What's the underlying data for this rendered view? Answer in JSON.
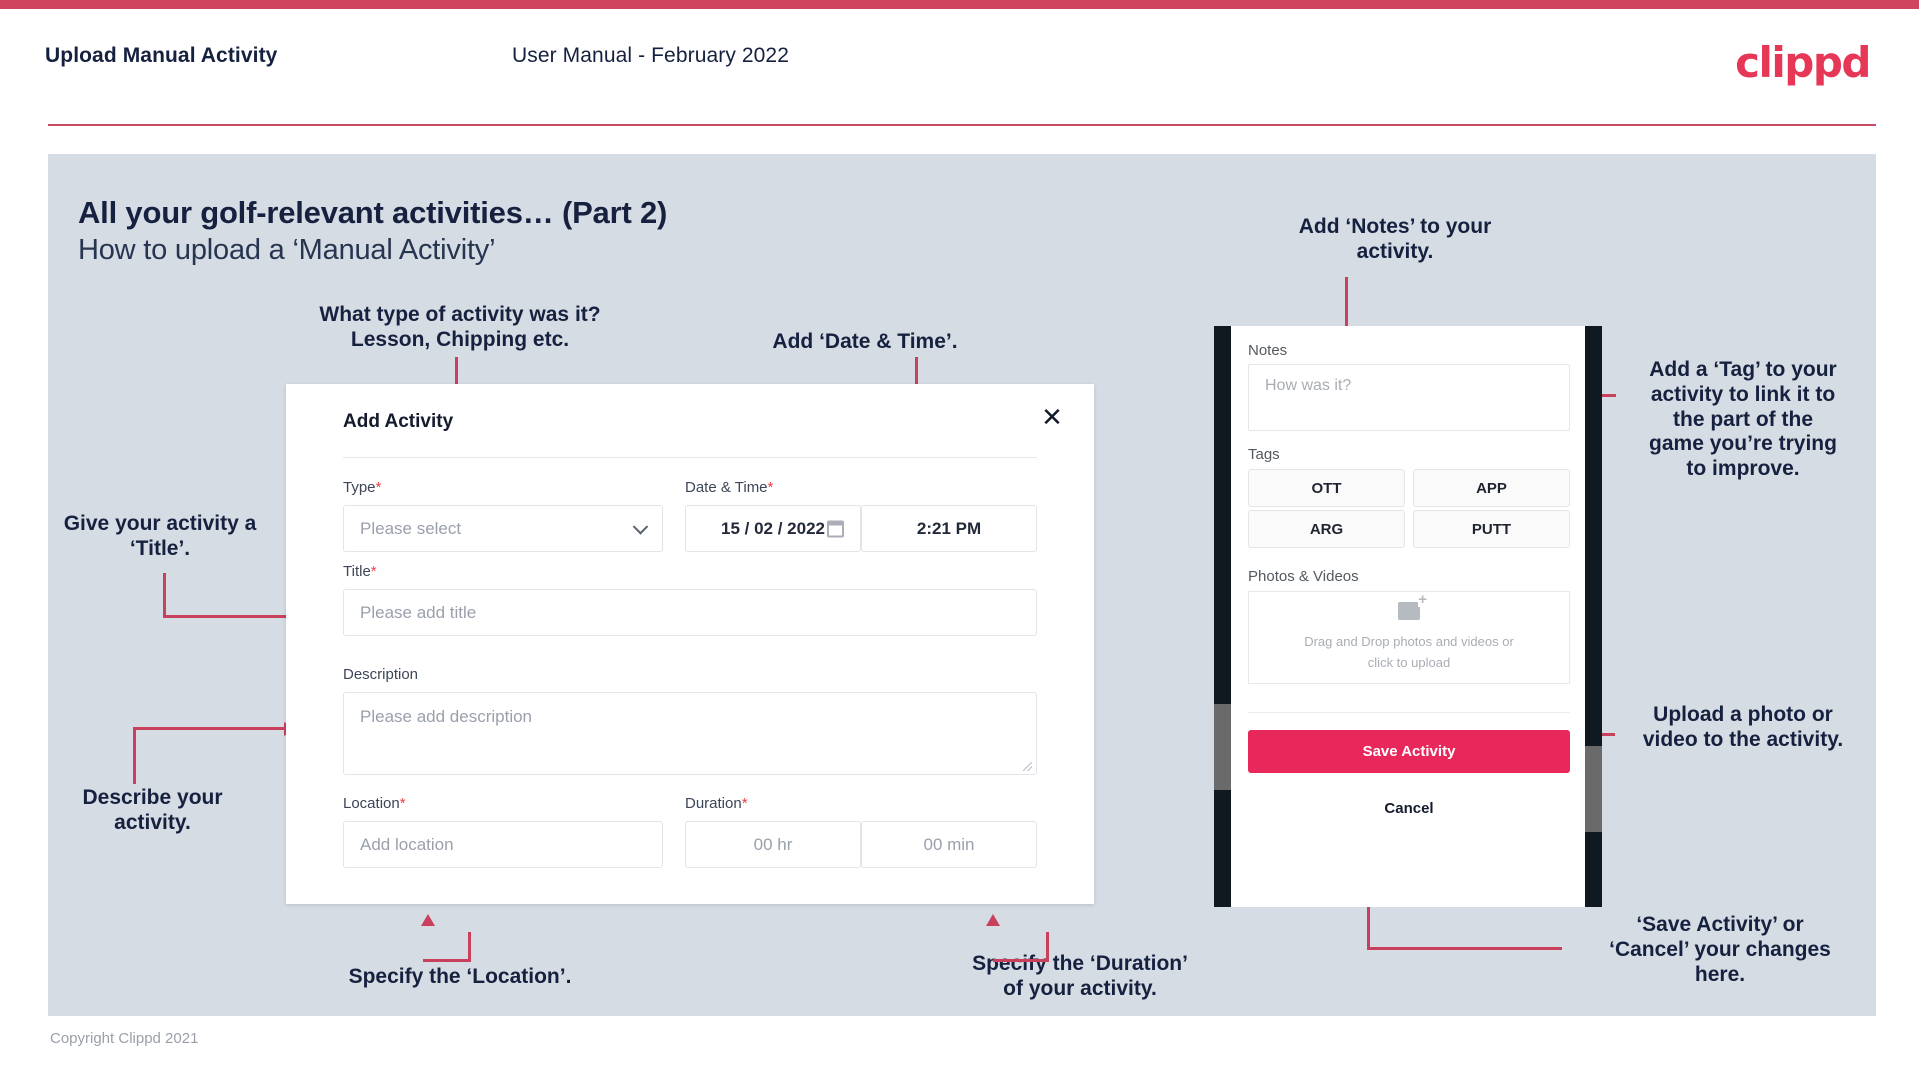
{
  "header": {
    "title": "Upload Manual Activity",
    "subtitle": "User Manual - February 2022",
    "brand": "clippd"
  },
  "slide": {
    "title": "All your golf-relevant activities… (Part 2)",
    "subtitle": "How to upload a ‘Manual Activity’"
  },
  "annotations": {
    "type": "What type of activity was it?\nLesson, Chipping etc.",
    "datetime": "Add ‘Date & Time’.",
    "title": "Give your activity a\n‘Title’.",
    "description": "Describe your\nactivity.",
    "location": "Specify the ‘Location’.",
    "duration": "Specify the ‘Duration’\nof your activity.",
    "notes": "Add ‘Notes’ to your\nactivity.",
    "tags": "Add a ‘Tag’ to your\nactivity to link it to\nthe part of the\ngame you’re trying\nto improve.",
    "upload": "Upload a photo or\nvideo to the activity.",
    "save": "‘Save Activity’ or\n‘Cancel’ your changes\nhere."
  },
  "dialog": {
    "title": "Add Activity",
    "close_icon": "close-icon",
    "fields": {
      "type": {
        "label": "Type",
        "required": "*",
        "placeholder": "Please select",
        "icon": "chevron-down-icon"
      },
      "datetime": {
        "label": "Date & Time",
        "required": "*",
        "date": "15 / 02 / 2022",
        "time": "2:21 PM",
        "icon": "calendar-icon"
      },
      "title": {
        "label": "Title",
        "required": "*",
        "placeholder": "Please add title"
      },
      "description": {
        "label": "Description",
        "required": "",
        "placeholder": "Please add description"
      },
      "location": {
        "label": "Location",
        "required": "*",
        "placeholder": "Add location"
      },
      "duration": {
        "label": "Duration",
        "required": "*",
        "hours": "00 hr",
        "minutes": "00 min"
      }
    }
  },
  "phone": {
    "notes": {
      "label": "Notes",
      "placeholder": "How was it?"
    },
    "tags": {
      "label": "Tags",
      "options": [
        "OTT",
        "APP",
        "ARG",
        "PUTT"
      ]
    },
    "photos": {
      "label": "Photos & Videos",
      "dropzone_text": "Drag and Drop photos and videos or\nclick to upload",
      "icon": "image-add-icon"
    },
    "save_label": "Save Activity",
    "cancel_label": "Cancel"
  },
  "footer": {
    "copyright": "Copyright Clippd 2021"
  },
  "colors": {
    "accent": "#e8275a",
    "brand": "#e63757",
    "arrow": "#c9405d",
    "slide_bg": "#d6dce4",
    "navy": "#16213f",
    "topbar": "#cf445e"
  }
}
